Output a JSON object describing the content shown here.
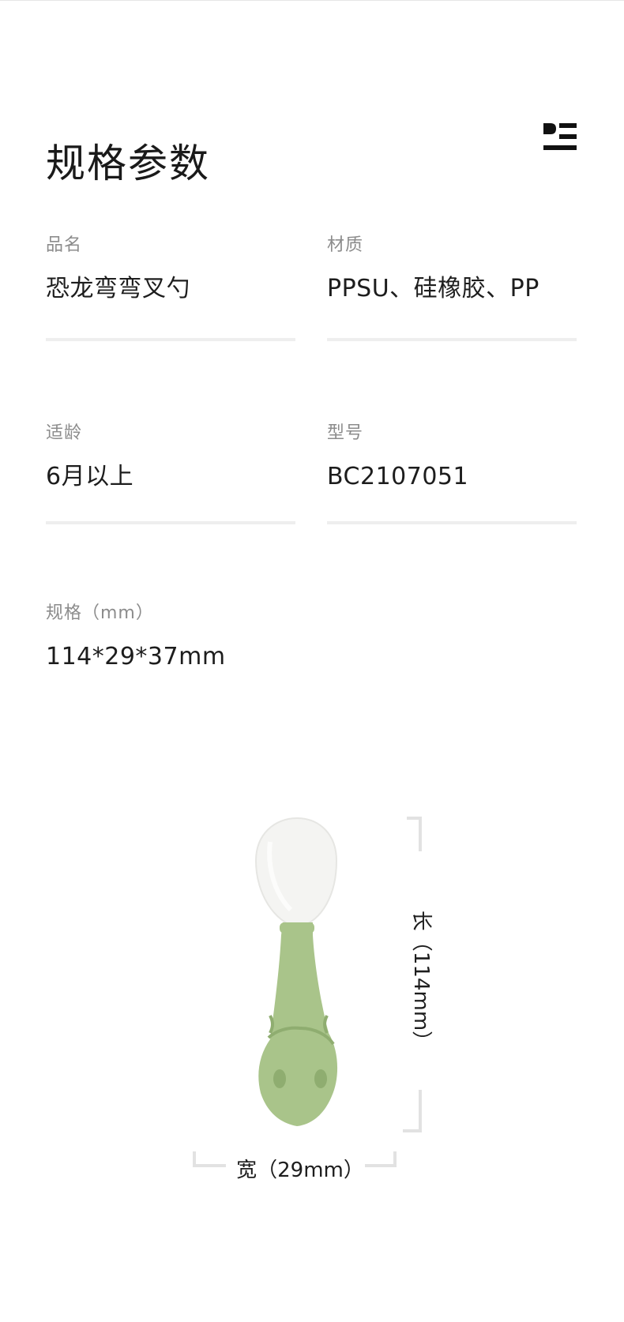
{
  "header": {
    "title": "规格参数",
    "logo_icon": "brand-logo-icon"
  },
  "specs": {
    "name": {
      "label": "品名",
      "value": "恐龙弯弯叉勺"
    },
    "material": {
      "label": "材质",
      "value": "PPSU、硅橡胶、PP"
    },
    "age": {
      "label": "适龄",
      "value": "6月以上"
    },
    "model": {
      "label": "型号",
      "value": "BC2107051"
    },
    "size": {
      "label": "规格（mm）",
      "value": "114*29*37mm"
    }
  },
  "illustration": {
    "length_label": "长（114mm）",
    "width_label": "宽（29mm）",
    "colors": {
      "handle": "#a9c48a",
      "bowl": "#f4f4f2",
      "bracket": "#e2e2e2"
    }
  }
}
